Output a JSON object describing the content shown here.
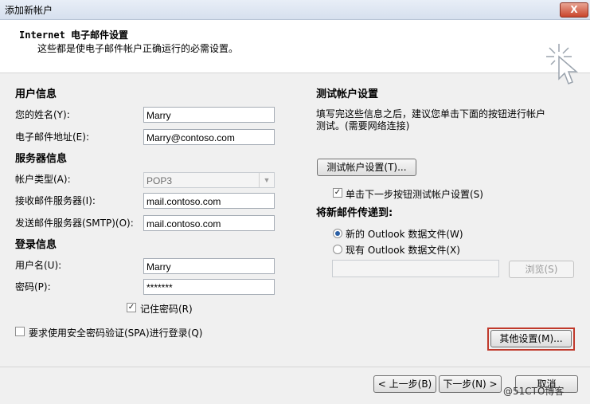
{
  "window": {
    "title": "添加新帐户",
    "close_label": "X"
  },
  "header": {
    "title": "Internet 电子邮件设置",
    "subtitle": "这些都是使电子邮件帐户正确运行的必需设置。",
    "icon": "cursor-sparkle-icon"
  },
  "user_info": {
    "heading": "用户信息",
    "name_label": "您的姓名(Y):",
    "name_value": "Marry",
    "email_label": "电子邮件地址(E):",
    "email_value": "Marry@contoso.com"
  },
  "server_info": {
    "heading": "服务器信息",
    "account_type_label": "帐户类型(A):",
    "account_type_value": "POP3",
    "incoming_label": "接收邮件服务器(I):",
    "incoming_value": "mail.contoso.com",
    "outgoing_label": "发送邮件服务器(SMTP)(O):",
    "outgoing_value": "mail.contoso.com"
  },
  "login_info": {
    "heading": "登录信息",
    "username_label": "用户名(U):",
    "username_value": "Marry",
    "password_label": "密码(P):",
    "password_value": "*******",
    "remember_label": "记住密码(R)",
    "remember_checked": true,
    "spa_label": "要求使用安全密码验证(SPA)进行登录(Q)",
    "spa_checked": false
  },
  "test": {
    "heading": "测试帐户设置",
    "description_line1": "填写完这些信息之后，建议您单击下面的按钮进行帐户",
    "description_line2": "测试。(需要网络连接)",
    "test_button": "测试帐户设置(T)...",
    "next_test_label": "单击下一步按钮测试帐户设置(S)",
    "next_test_checked": true
  },
  "deliver": {
    "heading": "将新邮件传递到:",
    "new_file_label": "新的 Outlook 数据文件(W)",
    "existing_file_label": "现有 Outlook 数据文件(X)",
    "selected": "new",
    "path_value": "",
    "browse_button": "浏览(S)"
  },
  "more_settings_button": "其他设置(M)...",
  "footer": {
    "back_button": "< 上一步(B)",
    "next_button": "下一步(N) >",
    "cancel_button": "取消"
  },
  "watermark": "@51CTO博客"
}
